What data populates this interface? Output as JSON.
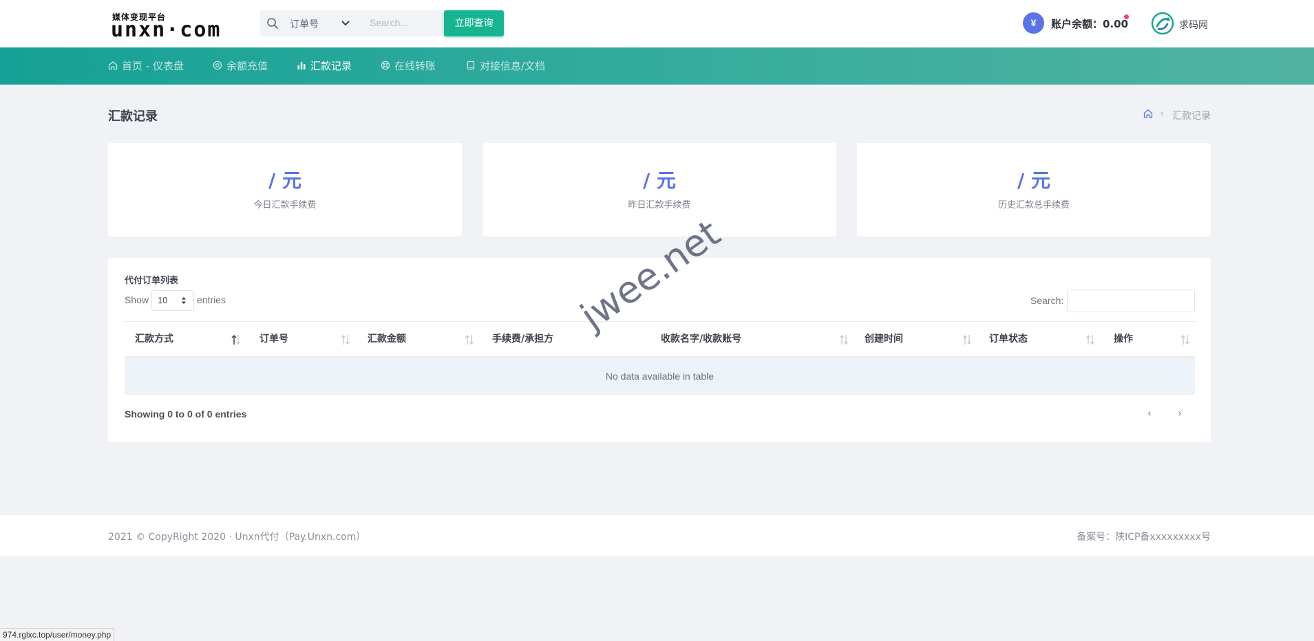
{
  "header": {
    "logo_tagline": "媒体变现平台",
    "logo_text": "unxn·com",
    "search_select": "订单号",
    "search_placeholder": "Search...",
    "search_button": "立即查询",
    "balance_icon": "¥",
    "balance_label": "账户余额：0.00",
    "user_name": "求码网"
  },
  "nav": {
    "items": [
      {
        "label": "首页 - 仪表盘",
        "icon": "home-icon"
      },
      {
        "label": "余额充值",
        "icon": "target-icon"
      },
      {
        "label": "汇款记录",
        "icon": "bar-chart-icon",
        "active": true
      },
      {
        "label": "在线转账",
        "icon": "lifebuoy-icon"
      },
      {
        "label": "对接信息/文档",
        "icon": "book-icon"
      }
    ]
  },
  "page": {
    "title": "汇款记录",
    "breadcrumb_current": "汇款记录"
  },
  "stats": [
    {
      "value": "/ 元",
      "label": "今日汇款手续费"
    },
    {
      "value": "/ 元",
      "label": "昨日汇款手续费"
    },
    {
      "value": "/ 元",
      "label": "历史汇款总手续费"
    }
  ],
  "table": {
    "title": "代付订单列表",
    "show_label": "Show",
    "page_size": "10",
    "entries_label": "entries",
    "search_label": "Search:",
    "columns": [
      "汇款方式",
      "订单号",
      "汇款金额",
      "手续费/承担方",
      "收款名字/收款账号",
      "创建时间",
      "订单状态",
      "操作"
    ],
    "empty_text": "No data available in table",
    "info": "Showing 0 to 0 of 0 entries",
    "prev": "‹",
    "next": "›"
  },
  "footer": {
    "left": "2021 © CopyRight 2020 · Unxn代付（Pay.Unxn.com）",
    "right": "备案号：陕ICP备xxxxxxxxx号"
  },
  "watermark": "jwee.net",
  "status_url": "974.rglxc.top/user/money.php",
  "colors": {
    "accent": "#5b73e8",
    "nav": "#16a196",
    "button": "#17b58f"
  }
}
